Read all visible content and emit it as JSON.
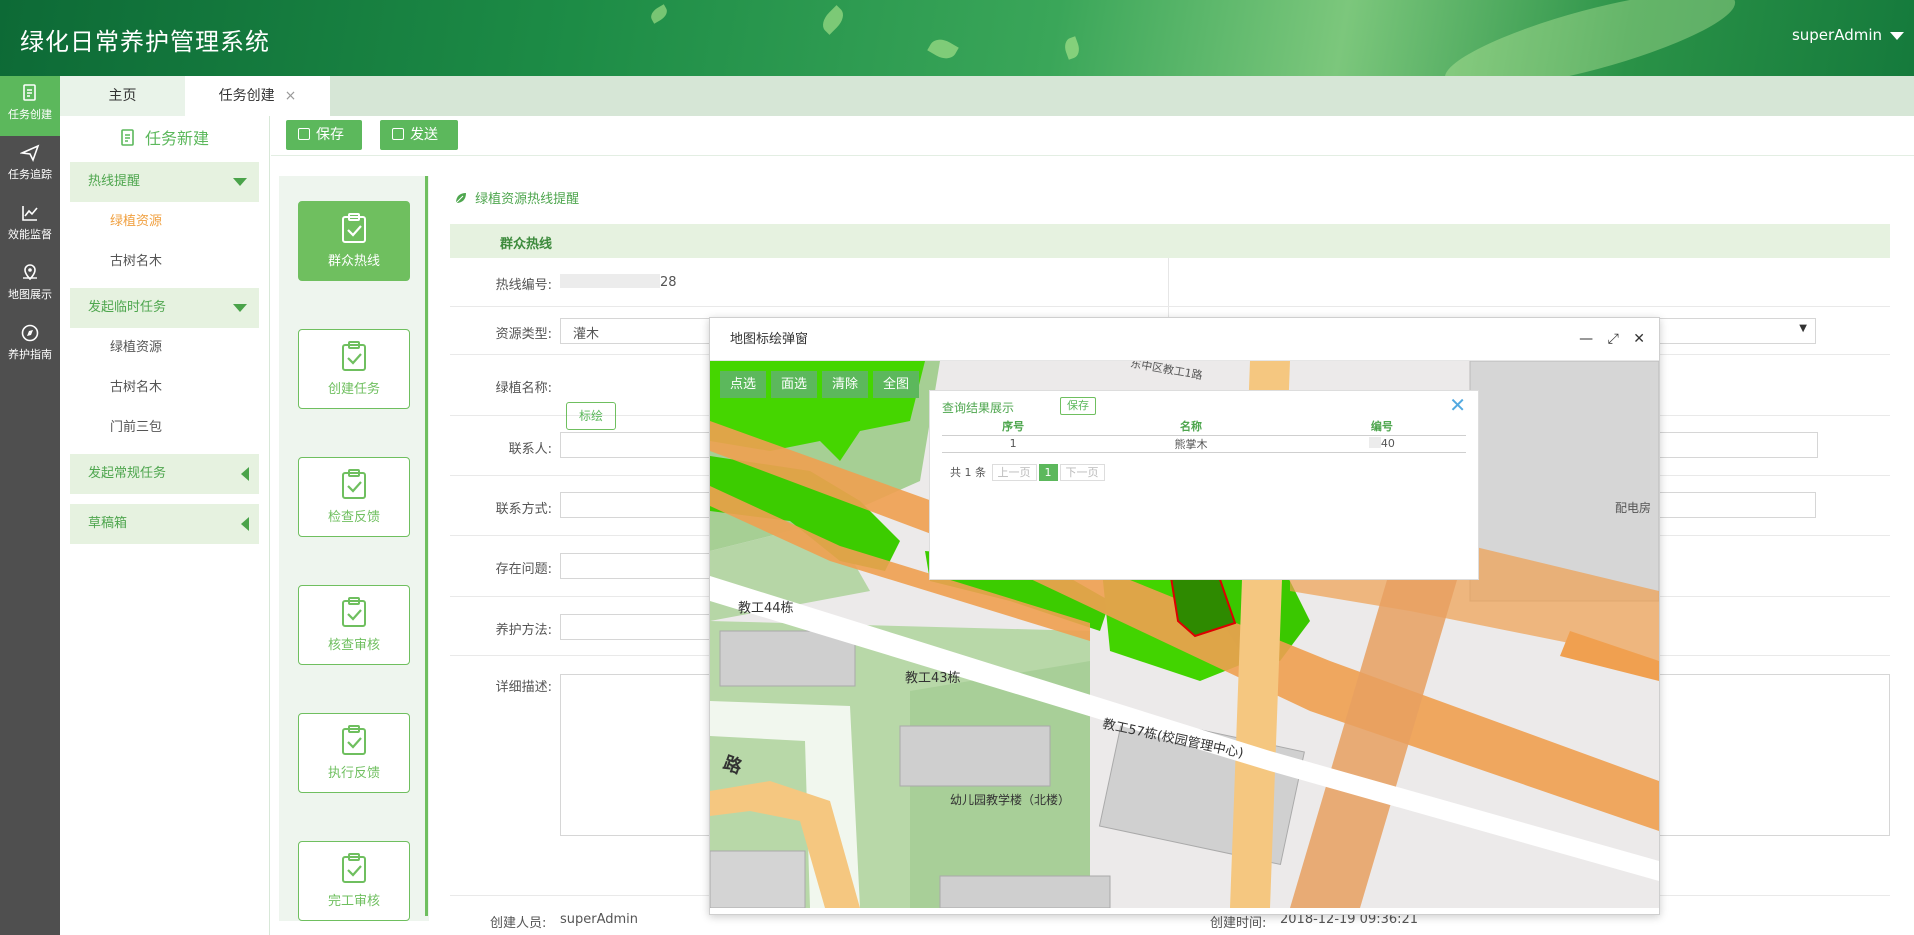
{
  "header": {
    "app_title": "绿化日常养护管理系统",
    "user": "superAdmin"
  },
  "rail": [
    {
      "label": "任务创建",
      "icon": "task-create-icon"
    },
    {
      "label": "任务追踪",
      "icon": "send-icon"
    },
    {
      "label": "效能监督",
      "icon": "chart-line-icon"
    },
    {
      "label": "地图展示",
      "icon": "map-pin-icon"
    },
    {
      "label": "养护指南",
      "icon": "compass-icon"
    }
  ],
  "tabs": {
    "home": "主页",
    "task": "任务创建",
    "close": "×"
  },
  "sidebar": {
    "title": "任务新建",
    "groups": [
      {
        "label": "热线提醒",
        "items": [
          "绿植资源",
          "古树名木"
        ]
      },
      {
        "label": "发起临时任务",
        "items": [
          "绿植资源",
          "古树名木",
          "门前三包"
        ]
      },
      {
        "label": "发起常规任务",
        "items": []
      },
      {
        "label": "草稿箱",
        "items": []
      }
    ]
  },
  "toolbar": {
    "save": "保存",
    "send": "发送"
  },
  "workflow": [
    "群众热线",
    "创建任务",
    "检查反馈",
    "核查审核",
    "执行反馈",
    "完工审核"
  ],
  "form": {
    "section_title": "绿植资源热线提醒",
    "group_title": "群众热线",
    "hotline_no_label": "热线编号:",
    "hotline_no_value": "28",
    "resource_type_label": "资源类型:",
    "resource_type_value": "灌木",
    "plant_name_label": "绿植名称:",
    "plant_name_button": "标绘",
    "contact_label": "联系人:",
    "contact_phone_label": "联系方式:",
    "problem_label": "存在问题:",
    "method_label": "养护方法:",
    "detail_label": "详细描述:",
    "creator_label": "创建人员:",
    "creator_value": "superAdmin",
    "created_time_label": "创建时间:",
    "created_time_value": "2018-12-19 09:36:21"
  },
  "dialog": {
    "title": "地图标绘弹窗",
    "map_tools": [
      "点选",
      "面选",
      "清除",
      "全图"
    ],
    "query": {
      "title": "查询结果展示",
      "save": "保存",
      "columns": [
        "序号",
        "名称",
        "编号"
      ],
      "rows": [
        [
          "1",
          "熊掌木",
          "40"
        ]
      ],
      "total": "共 1 条",
      "prev": "上一页",
      "page": "1",
      "next": "下一页"
    },
    "map_labels": {
      "b44": "教工44栋",
      "b43": "教工43栋",
      "b57": "教工57栋(校园管理中心)",
      "kinder": "幼儿园教学楼（北楼）",
      "road1": "东中区教工1路",
      "power": "配电房",
      "road_char": "路"
    }
  }
}
